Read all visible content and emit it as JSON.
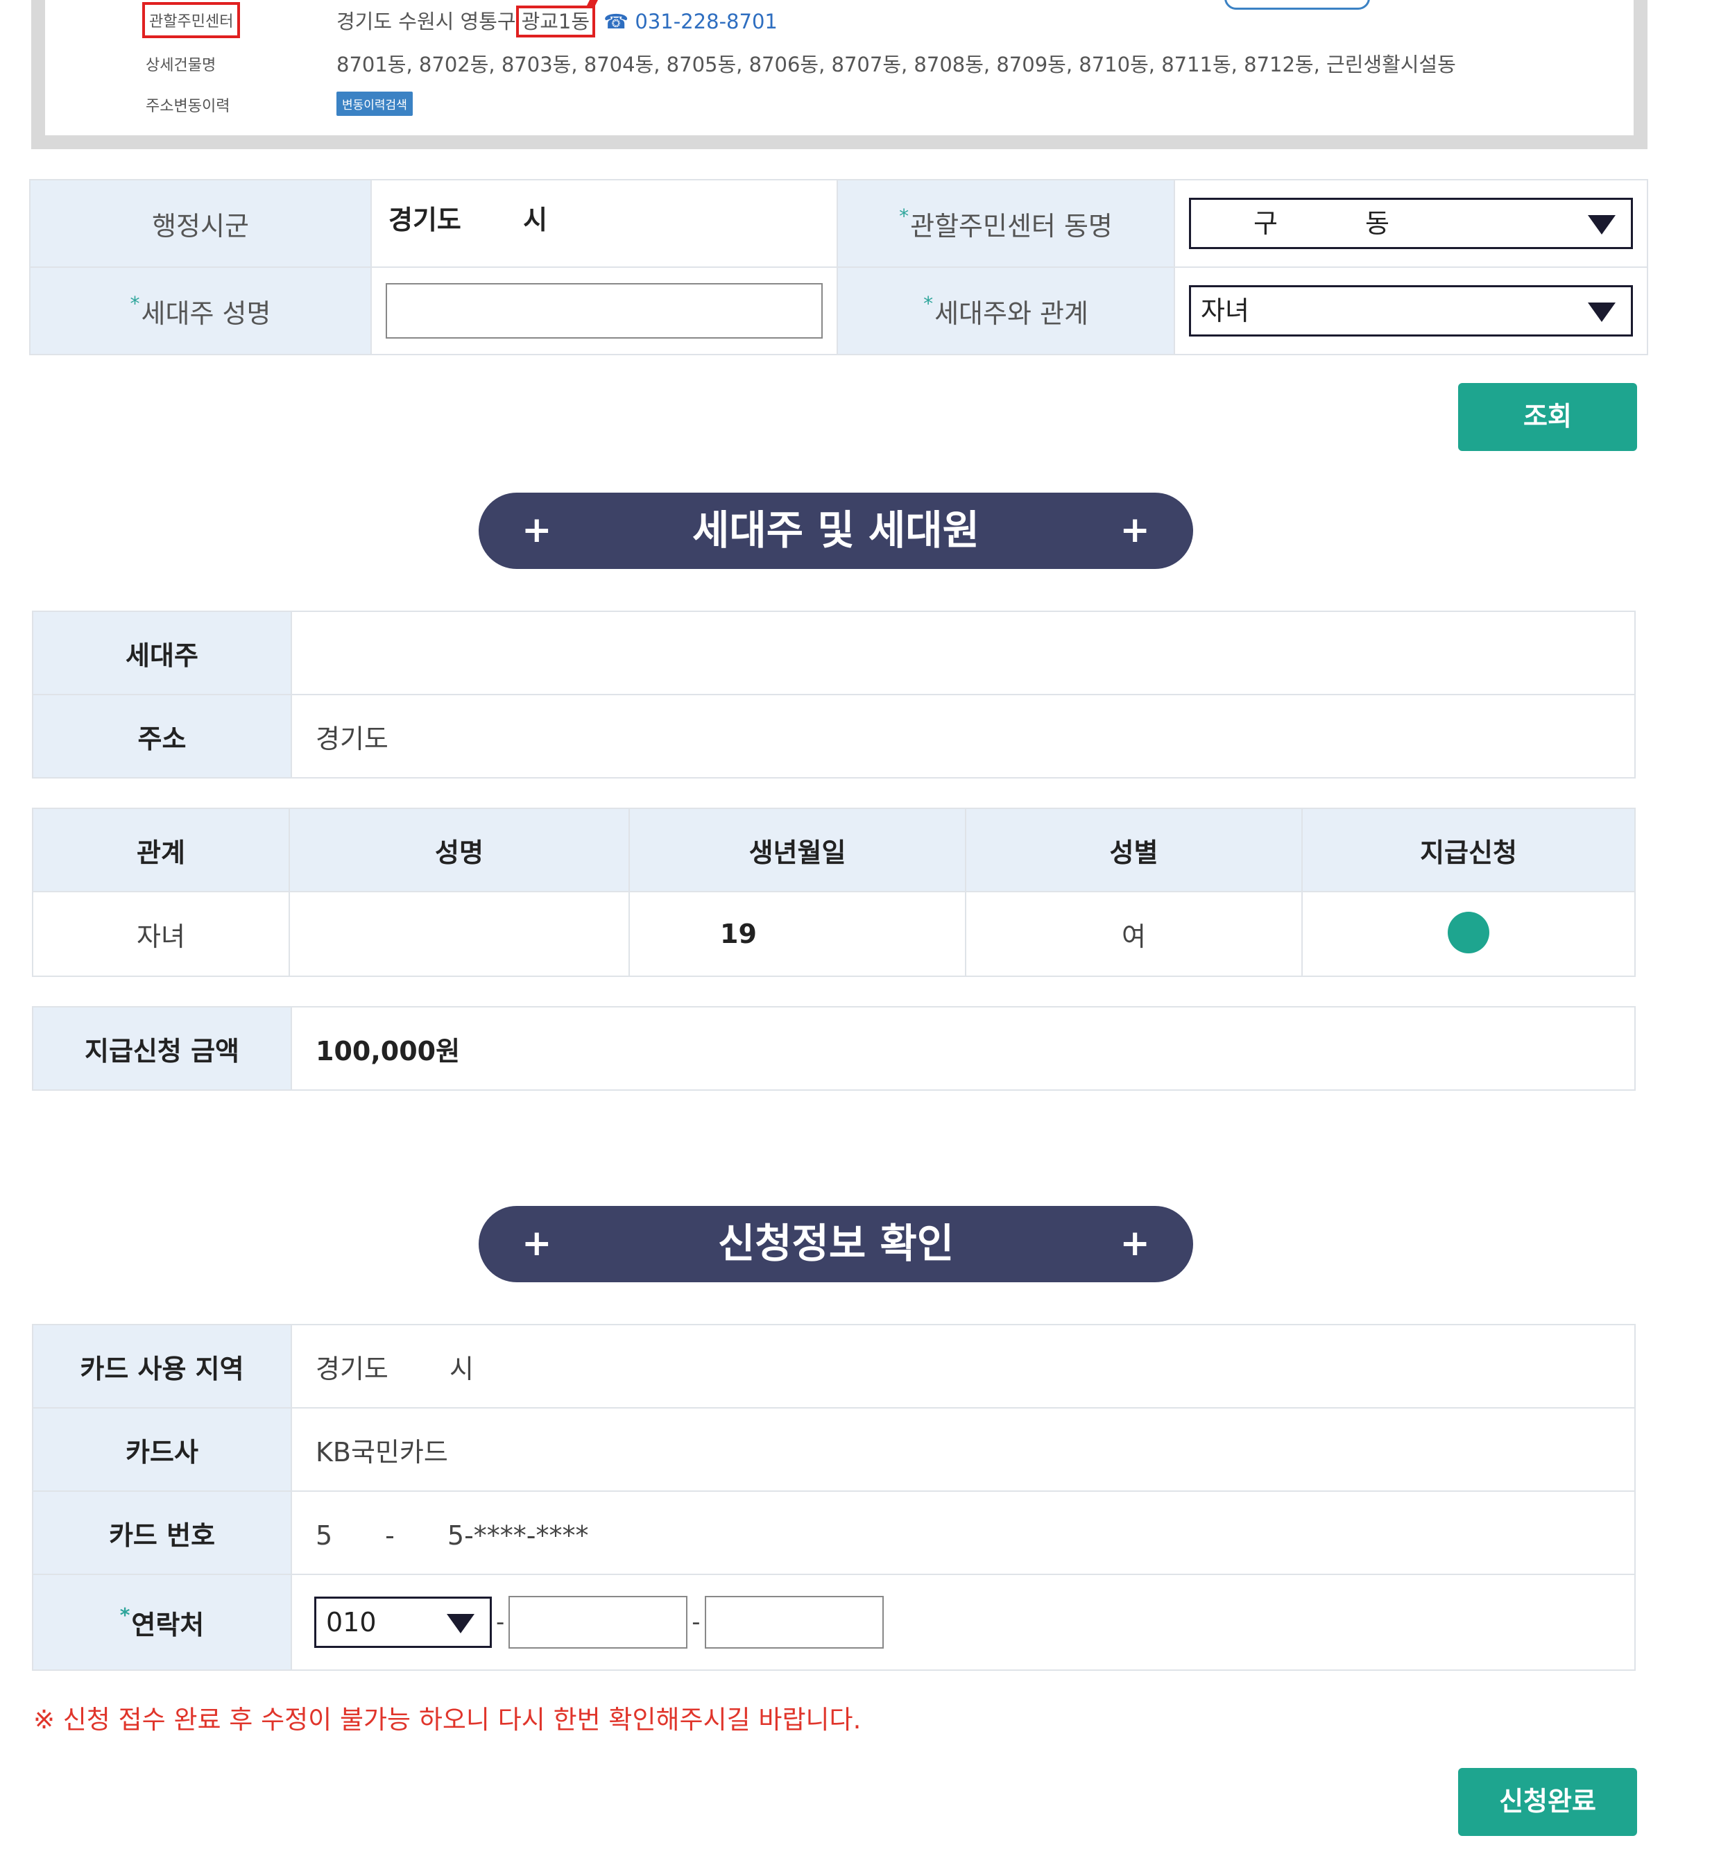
{
  "address_box": {
    "center_label": "관할주민센터",
    "center_value_prefix": "경기도 수원시 영통구",
    "center_value_dong": "광교1동",
    "center_phone": "☎ 031-228-8701",
    "building_label": "상세건물명",
    "building_value": "8701동, 8702동, 8703동, 8704동, 8705동, 8706동, 8707동, 8708동, 8709동, 8710동, 8711동, 8712동, 근린생활시설동",
    "history_label": "주소변동이력",
    "history_button": "변동이력검색"
  },
  "search_form": {
    "region_label": "행정시군",
    "region_value": "경기도 　　시",
    "center_name_label": "관할주민센터 동명",
    "center_name_value": "구 　　　동",
    "head_name_label": "세대주 성명",
    "head_name_value": "",
    "relation_label": "세대주와 관계",
    "relation_value": "자녀",
    "required_mark": "*",
    "search_button": "조회"
  },
  "section1": {
    "title": "세대주 및 세대원",
    "plus": "+"
  },
  "household": {
    "head_label": "세대주",
    "head_value": "",
    "address_label": "주소",
    "address_value": "경기도"
  },
  "members_table": {
    "headers": [
      "관계",
      "성명",
      "생년월일",
      "성별",
      "지급신청"
    ],
    "rows": [
      {
        "relation": "자녀",
        "name": "",
        "birth": "19",
        "gender": "여",
        "apply": true
      }
    ]
  },
  "amount": {
    "label": "지급신청 금액",
    "value": "100,000원"
  },
  "section2": {
    "title": "신청정보 확인",
    "plus": "+"
  },
  "confirm": {
    "region_label": "카드 사용 지역",
    "region_value": "경기도 　　시",
    "company_label": "카드사",
    "company_value": "KB국민카드",
    "number_label": "카드 번호",
    "number_value": "5　　-　　5-****-****",
    "contact_label": "연락처",
    "contact_prefix": "010",
    "contact_dash": "-"
  },
  "notice": "※ 신청 접수 완료 후 수정이 불가능 하오니 다시 한번 확인해주시길 바랍니다.",
  "submit_button": "신청완료",
  "colors": {
    "accent": "#1ea58f",
    "banner": "#3d4266",
    "label_bg": "#e7eff8",
    "notice": "#e0352b"
  }
}
